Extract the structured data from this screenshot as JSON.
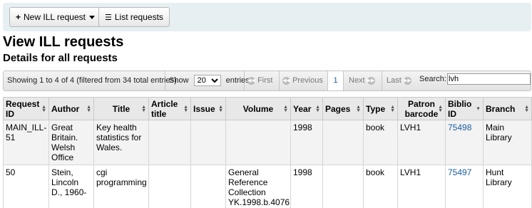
{
  "toolbar": {
    "new_request_label": "New ILL request",
    "list_requests_label": "List requests"
  },
  "heading": "View ILL requests",
  "subheading": "Details for all requests",
  "pager": {
    "info": "Showing 1 to 4 of 4 (filtered from 34 total entries)",
    "show_label": "Show",
    "page_size": "20",
    "entries_label": "entries",
    "first": "First",
    "previous": "Previous",
    "current_page": "1",
    "next": "Next",
    "last": "Last",
    "search_label": "Search:",
    "search_value": "lvh"
  },
  "table": {
    "columns": [
      "Request ID",
      "Author",
      "Title",
      "Article title",
      "Issue",
      "Volume",
      "Year",
      "Pages",
      "Type",
      "Patron barcode",
      "Biblio ID",
      "Branch"
    ],
    "rows": [
      {
        "request_id": "MAIN_ILL-51",
        "author": "Great Britain. Welsh Office",
        "title": "Key health statistics for Wales.",
        "article_title": "",
        "issue": "",
        "volume": "",
        "year": "1998",
        "pages": "",
        "type": "book",
        "patron_barcode": "LVH1",
        "biblio_id": "75498",
        "branch": "Main Library"
      },
      {
        "request_id": "50",
        "author": "Stein, Lincoln D., 1960-",
        "title": "cgi programming",
        "article_title": "",
        "issue": "",
        "volume": "General Reference Collection YK.1998.b.4076",
        "year": "1998",
        "pages": "",
        "type": "book",
        "patron_barcode": "LVH1",
        "biblio_id": "75497",
        "branch": "Hunt Library"
      }
    ]
  }
}
